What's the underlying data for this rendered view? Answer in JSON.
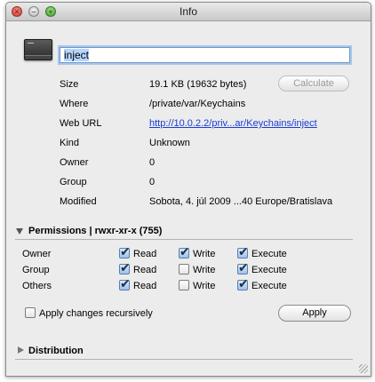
{
  "window": {
    "title": "Info"
  },
  "name_field": {
    "value": "inject"
  },
  "info_rows": [
    {
      "label": "Size",
      "value": "19.1 KB (19632 bytes)"
    },
    {
      "label": "Where",
      "value": "/private/var/Keychains"
    },
    {
      "label": "Web URL",
      "value": "http://10.0.2.2/priv...ar/Keychains/inject"
    },
    {
      "label": "Kind",
      "value": "Unknown"
    },
    {
      "label": "Owner",
      "value": "0"
    },
    {
      "label": "Group",
      "value": "0"
    },
    {
      "label": "Modified",
      "value": "Sobota, 4. júl 2009 ...40 Europe/Bratislava"
    }
  ],
  "calculate_button": {
    "label": "Calculate",
    "enabled": false
  },
  "permissions": {
    "header": "Permissions | rwxr-xr-x (755)",
    "columns": [
      "Read",
      "Write",
      "Execute"
    ],
    "rows": [
      {
        "label": "Owner",
        "read": true,
        "write": true,
        "execute": true
      },
      {
        "label": "Group",
        "read": true,
        "write": false,
        "execute": true
      },
      {
        "label": "Others",
        "read": true,
        "write": false,
        "execute": true
      }
    ],
    "apply_recursively": {
      "label": "Apply changes recursively",
      "checked": false
    },
    "apply_button": "Apply"
  },
  "distribution": {
    "header": "Distribution",
    "expanded": false
  },
  "colors": {
    "link": "#1a3cd0",
    "focus_ring": "#a8c6ea",
    "selection": "#b5d5ff"
  }
}
